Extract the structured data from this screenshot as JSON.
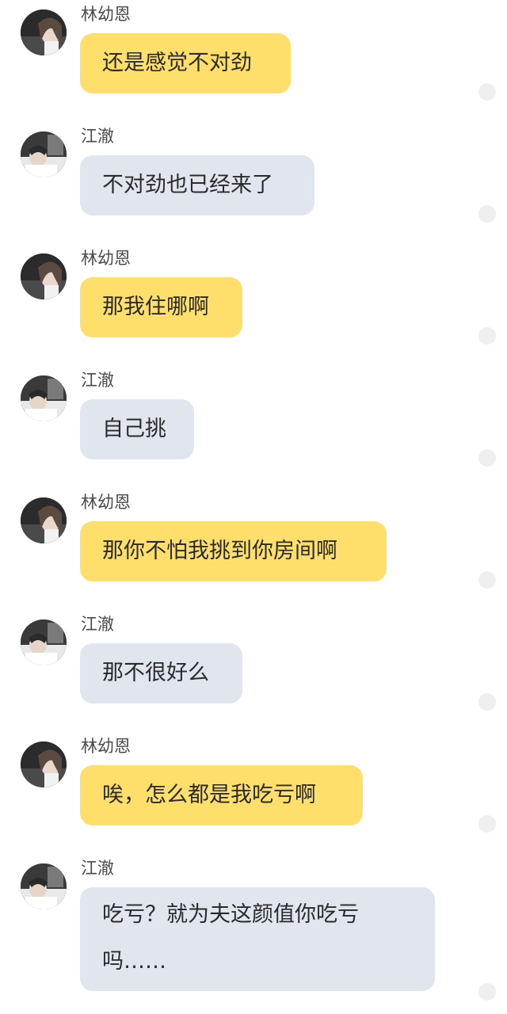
{
  "messages": [
    {
      "sender": "林幼恩",
      "text": "还是感觉不对劲",
      "type": "her"
    },
    {
      "sender": "江澈",
      "text": "不对劲也已经来了",
      "type": "him"
    },
    {
      "sender": "林幼恩",
      "text": "那我住哪啊",
      "type": "her"
    },
    {
      "sender": "江澈",
      "text": "自己挑",
      "type": "him"
    },
    {
      "sender": "林幼恩",
      "text": "那你不怕我挑到你房间啊",
      "type": "her"
    },
    {
      "sender": "江澈",
      "text": "那不很好么",
      "type": "him"
    },
    {
      "sender": "林幼恩",
      "text": "唉，怎么都是我吃亏啊",
      "type": "her"
    },
    {
      "sender": "江澈",
      "lines": [
        "吃亏？就为夫这颜值你吃亏",
        "吗……"
      ],
      "type": "him"
    }
  ],
  "colors": {
    "her_bubble": "#fedf6b",
    "him_bubble": "#e1e6ee",
    "status_dot": "#efefef"
  }
}
